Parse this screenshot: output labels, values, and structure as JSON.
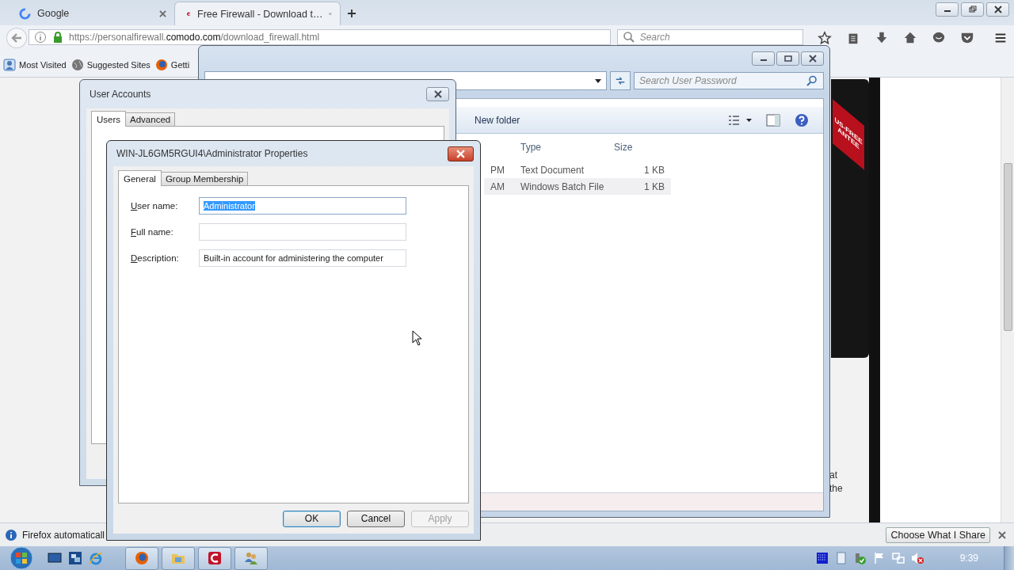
{
  "browser": {
    "tabs": [
      {
        "title": "Google",
        "selected": false
      },
      {
        "title": "Free Firewall - Download t…",
        "selected": true
      }
    ],
    "url": {
      "prefix": "https://personalfirewall.",
      "domain": "comodo.com",
      "path": "/download_firewall.html"
    },
    "search_placeholder": "Search",
    "bookmarks": [
      "Most Visited",
      "Suggested Sites",
      "Getti"
    ],
    "ribbon": [
      "US-FREE",
      "ANTEE"
    ],
    "page_text": [
      "at",
      "the"
    ],
    "notification": {
      "text": "Firefox automaticall",
      "button": "Choose What I Share"
    }
  },
  "explorer": {
    "search_placeholder": "Search User Password",
    "toolbar_button": "New folder",
    "columns": [
      "Type",
      "Size"
    ],
    "rows": [
      {
        "date": "PM",
        "type": "Text Document",
        "size": "1 KB",
        "selected": false
      },
      {
        "date": "AM",
        "type": "Windows Batch File",
        "size": "1 KB",
        "selected": true
      }
    ]
  },
  "user_accounts": {
    "title": "User Accounts",
    "tabs": [
      {
        "label": "Users",
        "selected": true
      },
      {
        "label": "Advanced",
        "selected": false
      }
    ]
  },
  "properties": {
    "title": "WIN-JL6GM5RGUI4\\Administrator Properties",
    "tabs": [
      {
        "label": "General",
        "selected": true
      },
      {
        "label": "Group Membership",
        "selected": false
      }
    ],
    "fields": [
      {
        "label": "User name:",
        "value": "Administrator",
        "text_selected": true
      },
      {
        "label": "Full name:",
        "text_selected": false
      },
      {
        "label": "Description:",
        "value": "Built-in account for administering the computer",
        "text_selected": false
      }
    ],
    "buttons": [
      {
        "label": "OK",
        "default": true,
        "disabled": false
      },
      {
        "label": "Cancel",
        "default": false,
        "disabled": false
      },
      {
        "label": "Apply",
        "default": false,
        "disabled": true
      }
    ]
  },
  "taskbar": {
    "clock": "9:39"
  }
}
